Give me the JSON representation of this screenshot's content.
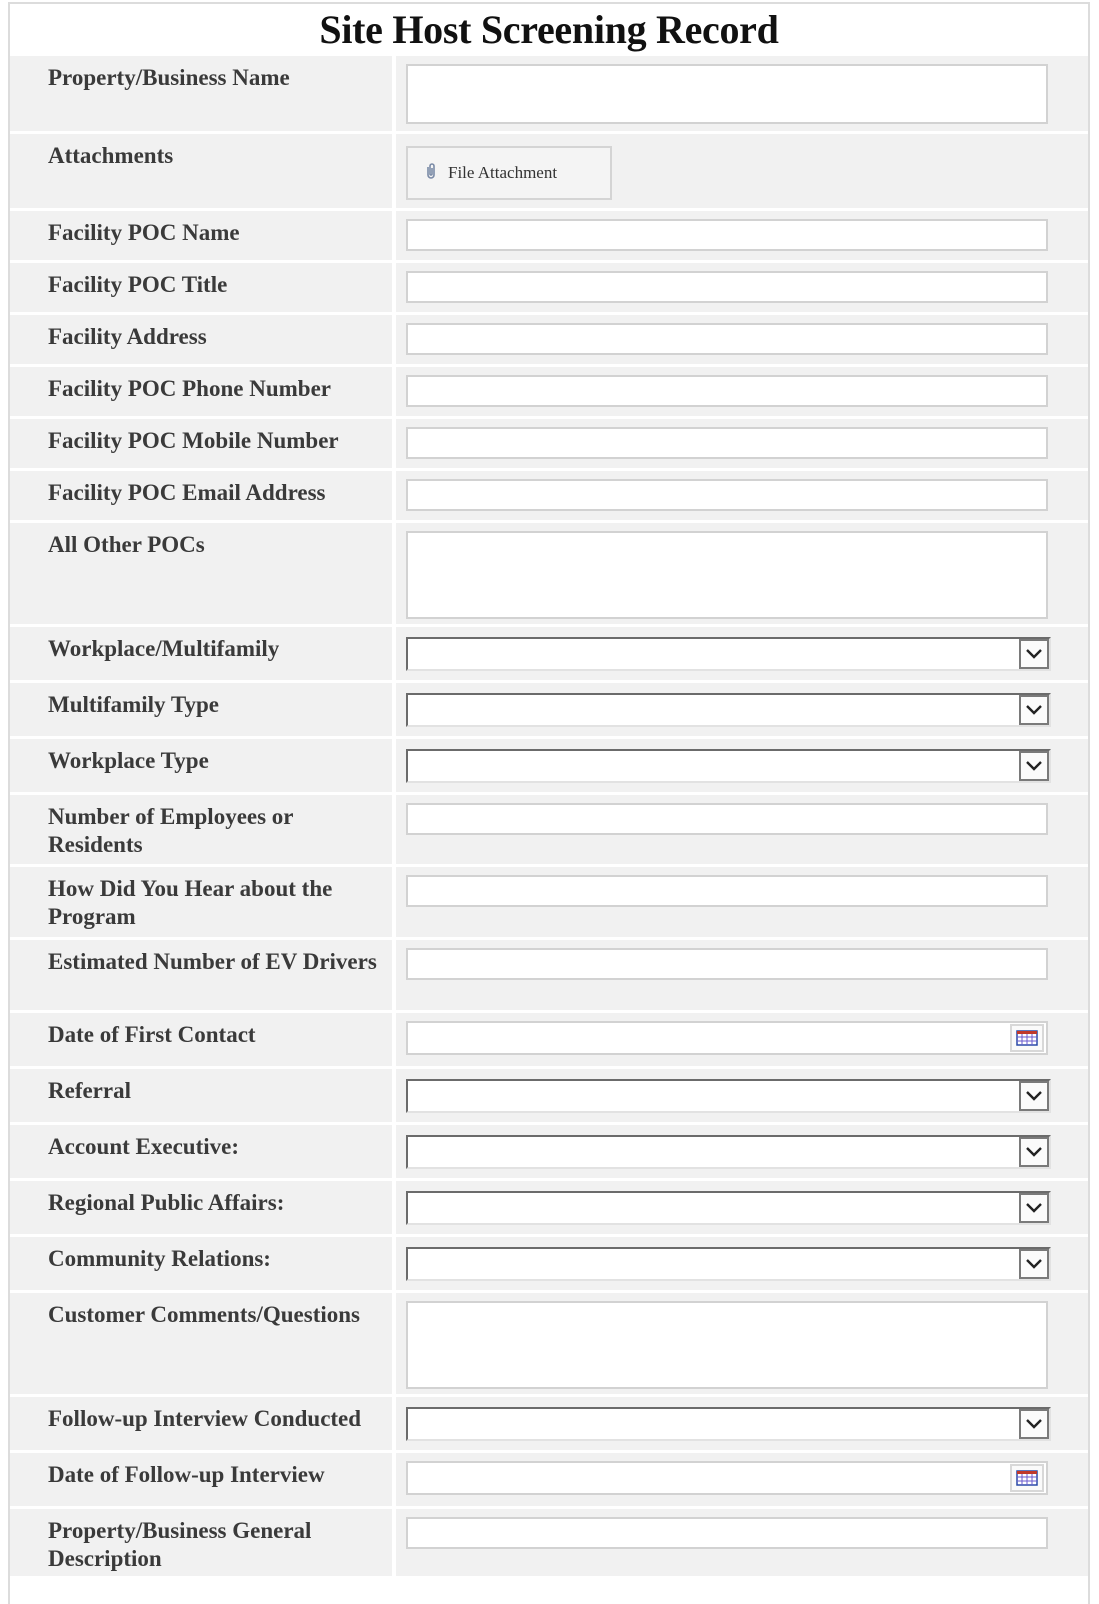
{
  "form": {
    "title": "Site Host Screening Record",
    "attachment_button_label": "File Attachment",
    "fields": [
      {
        "label": "Property/Business Name"
      },
      {
        "label": "Attachments"
      },
      {
        "label": "Facility POC Name"
      },
      {
        "label": "Facility POC Title"
      },
      {
        "label": "Facility Address"
      },
      {
        "label": "Facility POC Phone Number"
      },
      {
        "label": "Facility POC Mobile Number"
      },
      {
        "label": "Facility POC Email Address"
      },
      {
        "label": "All Other POCs"
      },
      {
        "label": "Workplace/Multifamily"
      },
      {
        "label": "Multifamily Type"
      },
      {
        "label": "Workplace Type"
      },
      {
        "label": "Number of Employees or Residents"
      },
      {
        "label": "How Did You Hear about the Program"
      },
      {
        "label": "Estimated Number of EV Drivers"
      },
      {
        "label": "Date of First Contact"
      },
      {
        "label": "Referral"
      },
      {
        "label": "Account Executive:"
      },
      {
        "label": "Regional Public Affairs:"
      },
      {
        "label": "Community Relations:"
      },
      {
        "label": "Customer Comments/Questions"
      },
      {
        "label": "Follow-up Interview Conducted"
      },
      {
        "label": "Date of Follow-up Interview"
      },
      {
        "label": "Property/Business General Description"
      }
    ]
  },
  "icons": {
    "attachment": "paperclip-icon",
    "dropdown": "chevron-down-icon",
    "date": "calendar-icon"
  },
  "colors": {
    "label_background": "#f1f1f1",
    "label_text": "#3a3a3a",
    "title_text": "#111111",
    "field_border": "#d2d2d2"
  }
}
